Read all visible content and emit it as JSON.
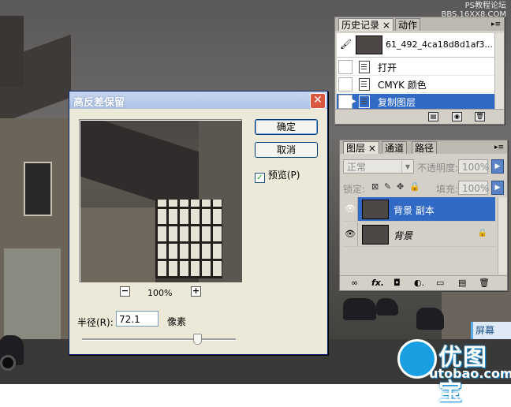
{
  "watermark_top": "PS教程论坛\nBBS.16XX8.COM",
  "logo": {
    "cn": "优图宝",
    "en": "utobao.com"
  },
  "sign_text": "屏幕",
  "dialog": {
    "title": "高反差保留",
    "ok_label": "确定",
    "cancel_label": "取消",
    "preview_label": "预览(P)",
    "preview_checked": true,
    "zoom_minus": "−",
    "zoom_plus": "+",
    "zoom_level": "100%",
    "radius_label": "半径(R):",
    "radius_value": "72.1",
    "radius_unit": "像素",
    "slider_fraction": 0.75
  },
  "history": {
    "tabs": [
      {
        "label": "历史记录 ×",
        "active": true
      },
      {
        "label": "动作",
        "active": false
      }
    ],
    "snapshot_name": "61_492_4ca18d8d1af3...",
    "items": [
      {
        "label": "打开",
        "selected": false
      },
      {
        "label": "CMYK 颜色",
        "selected": false
      },
      {
        "label": "复制图层",
        "selected": true
      }
    ]
  },
  "layers": {
    "tabs": [
      {
        "label": "图层 ×",
        "active": true
      },
      {
        "label": "通道",
        "active": false
      },
      {
        "label": "路径",
        "active": false
      }
    ],
    "blend_mode": "正常",
    "opacity_label": "不透明度:",
    "opacity_value": "100%",
    "lock_label": "锁定:",
    "fill_label": "填充:",
    "fill_value": "100%",
    "items": [
      {
        "name": "背景 副本",
        "selected": true,
        "locked": false
      },
      {
        "name": "背景",
        "selected": false,
        "locked": true
      }
    ]
  }
}
